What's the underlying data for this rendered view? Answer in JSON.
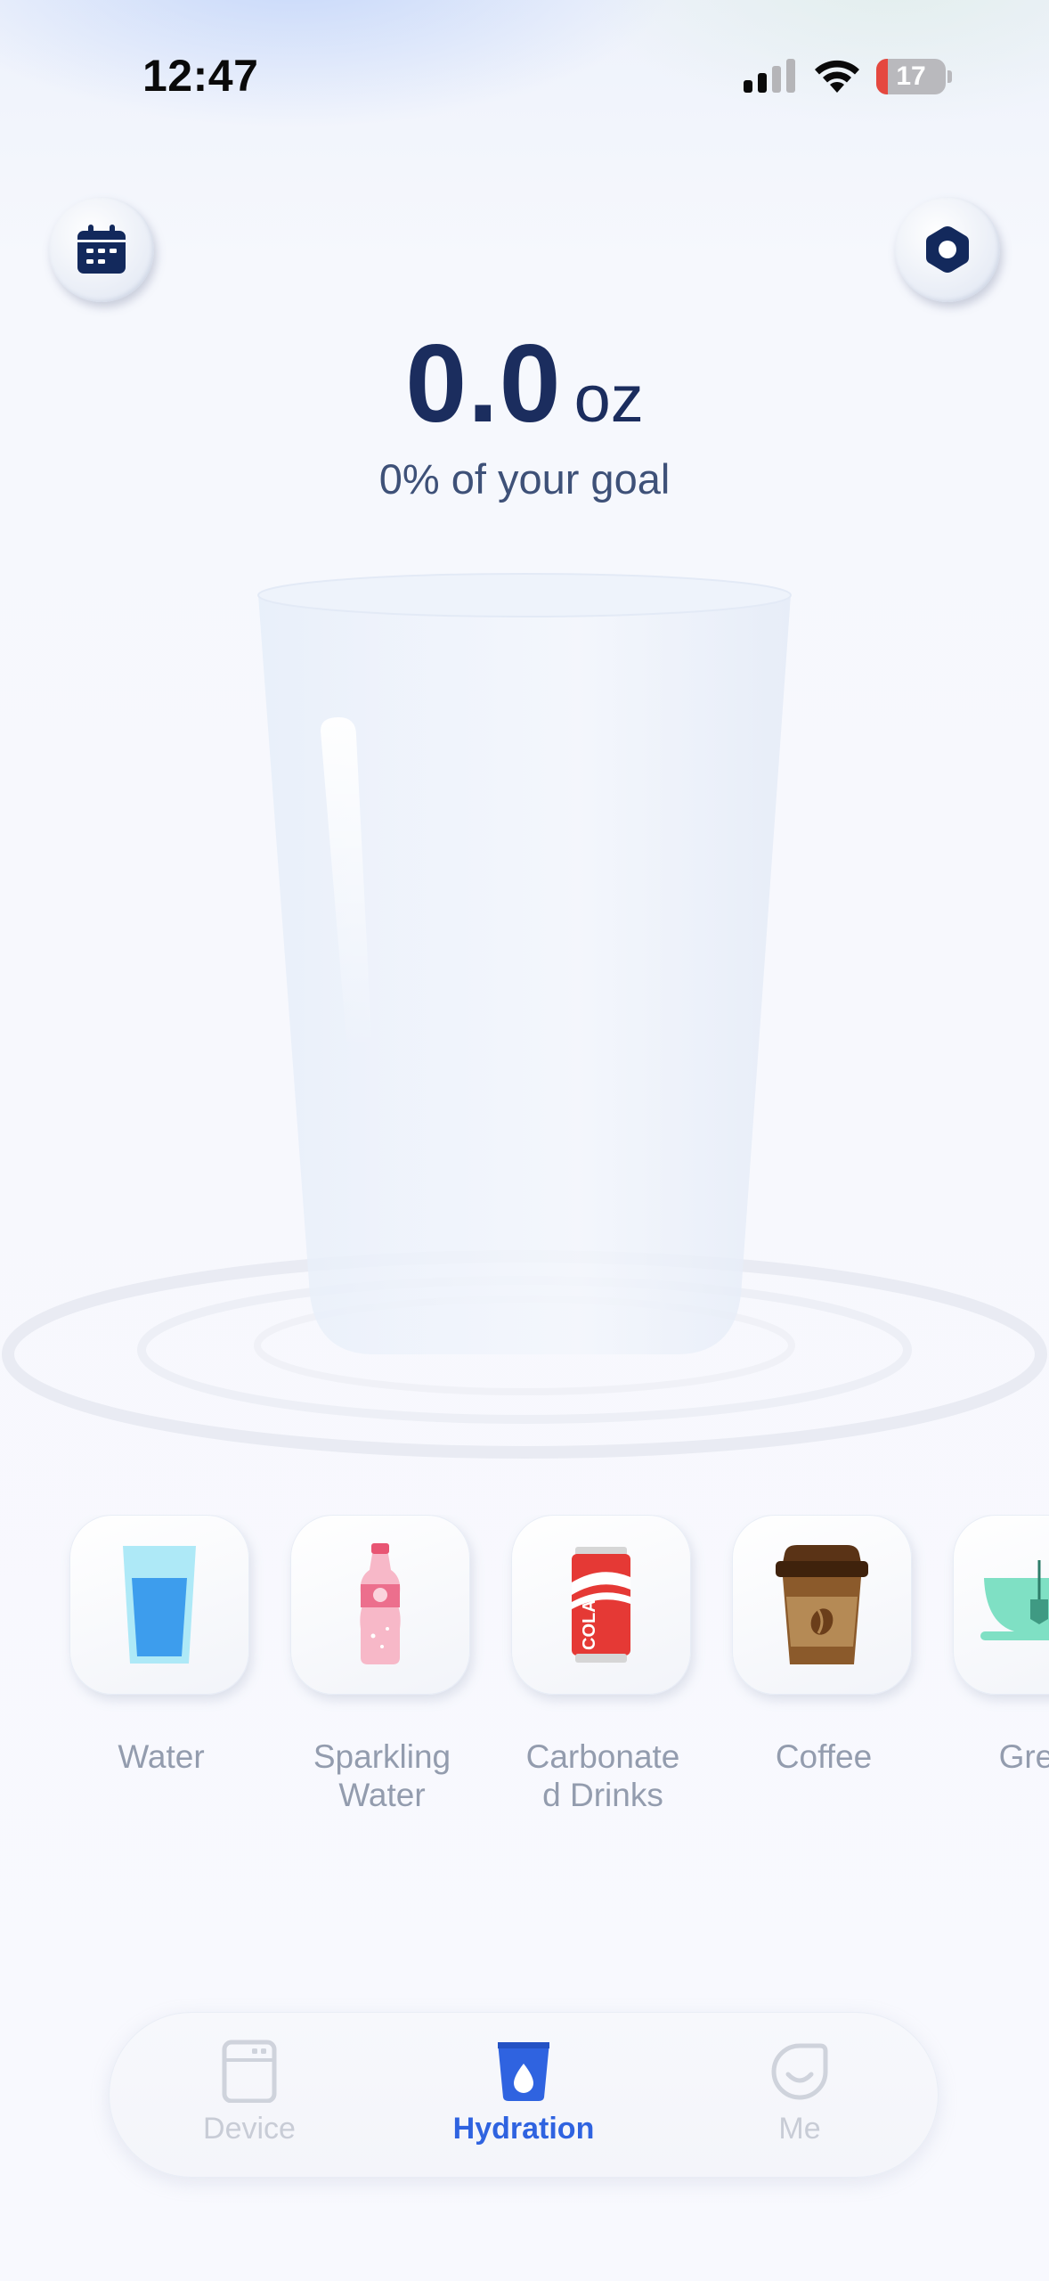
{
  "status_bar": {
    "time": "12:47",
    "battery_level": "17",
    "battery_color": "#e5483f"
  },
  "header": {
    "calendar_icon": "calendar-icon",
    "settings_icon": "hexagon-settings-icon"
  },
  "intake": {
    "value": "0.0",
    "unit": "oz",
    "goal_text": "0% of your goal",
    "fill_fraction": 0
  },
  "drinks": [
    {
      "label": "Water",
      "icon": "water-glass-icon"
    },
    {
      "label": "Sparkling\nWater",
      "icon": "sparkling-water-bottle-icon"
    },
    {
      "label": "Carbonate\nd Drinks",
      "icon": "cola-can-icon"
    },
    {
      "label": "Coffee",
      "icon": "coffee-cup-icon"
    },
    {
      "label": "Green",
      "icon": "green-tea-cup-icon"
    }
  ],
  "cola_can_text": "COLA",
  "nav": {
    "items": [
      {
        "label": "Device",
        "icon": "device-icon",
        "active": false
      },
      {
        "label": "Hydration",
        "icon": "hydration-cup-icon",
        "active": true
      },
      {
        "label": "Me",
        "icon": "smile-icon",
        "active": false
      }
    ],
    "active_color": "#2f63e0",
    "inactive_color": "#c8ccd6"
  }
}
